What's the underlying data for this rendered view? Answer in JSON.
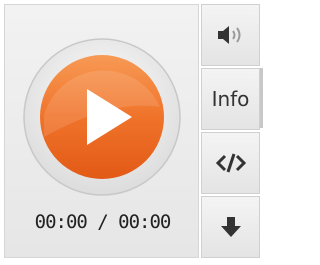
{
  "player": {
    "time_display": "00:00 / 00:00",
    "play_state": "paused",
    "accent_color": "#f0732a"
  },
  "side_bar": {
    "buttons": [
      {
        "icon": "volume-icon",
        "label": ""
      },
      {
        "icon": "",
        "label": "Info"
      },
      {
        "icon": "embed-code-icon",
        "label": ""
      },
      {
        "icon": "download-arrow-icon",
        "label": ""
      }
    ]
  }
}
